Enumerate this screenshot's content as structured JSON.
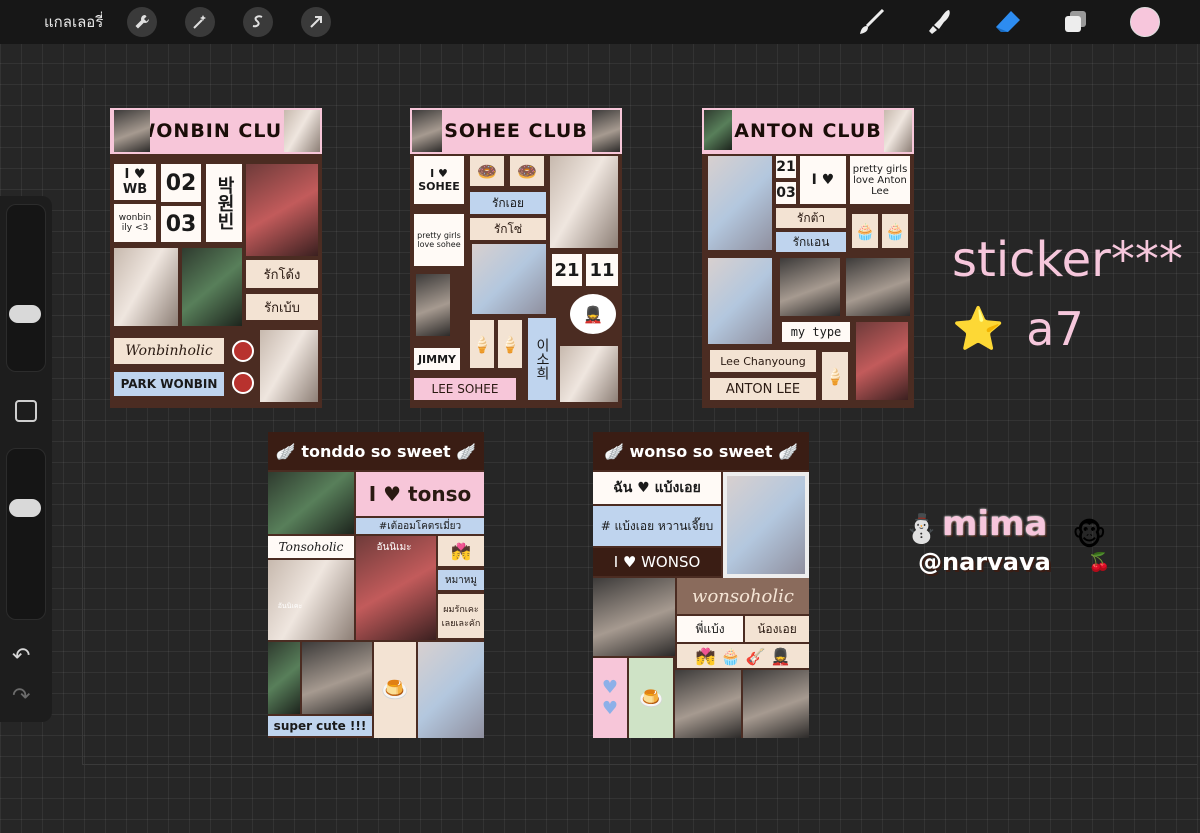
{
  "topbar": {
    "gallery_label": "แกลเลอรี่",
    "left_tools": [
      "wrench-icon",
      "magic-wand-icon",
      "selection-s-icon",
      "move-arrow-icon"
    ],
    "right_tools": [
      "brush-icon",
      "smudge-icon",
      "eraser-icon",
      "layers-icon"
    ],
    "current_color": "#f7c6dc"
  },
  "sheets": {
    "wonbin": {
      "title": "WONBIN CLUB",
      "i_love": "I ♥ WB",
      "date_day": "02",
      "date_month": "03",
      "korean": "박원빈",
      "wonbin_ily": "wonbin ily <3",
      "love_1": "รักโด้ง",
      "love_2": "รักเบ้บ",
      "holic": "Wonbinholic",
      "name": "PARK WONBIN"
    },
    "sohee": {
      "title": "SOHEE CLUB",
      "i_love": "I ♥ SOHEE",
      "love_1": "รักเอย",
      "love_2": "รักโซ่",
      "pretty": "pretty girls love sohee",
      "date_day": "21",
      "date_month": "11",
      "korean": "이소희",
      "jimmy": "JIMMY",
      "name": "LEE SOHEE"
    },
    "anton": {
      "title": "ANTON CLUB",
      "date_day": "21",
      "date_month": "03",
      "i_love": "I ♥",
      "pretty": "pretty girls love Anton Lee",
      "love_1": "รักต้า",
      "love_2": "รักแอน",
      "my_type": "my type",
      "name_kr": "Lee Chanyoung",
      "name": "ANTON LEE"
    },
    "tonddo": {
      "title": "tonddo so sweet",
      "i_love": "I ♥ tonso",
      "hashtag": "#เต้ออมโคตรเมี่ยว",
      "holic": "Tonsoholic",
      "t1": "อันนิเมะ",
      "t2": "หมาหมู",
      "t3": "ผมรักเคะ เลยเละคัก",
      "t4": "อันนิเคะ",
      "cute": "super cute !!!"
    },
    "wonso": {
      "title": "wonso so sweet",
      "love_line": "ฉัน ♥ แบ้งเอย",
      "hashtag": "# แบ้งเอย หวานเจี๊ยบ",
      "i_love": "I ♥ WONSO",
      "holic": "wonsoholic",
      "t1": "พี่แบ้ง",
      "t2": "น้องเอย"
    }
  },
  "side": {
    "line1": "sticker***",
    "line2": "a7",
    "star": "⭐"
  },
  "watermark": {
    "line1": "mima",
    "line2": "@narvava"
  }
}
